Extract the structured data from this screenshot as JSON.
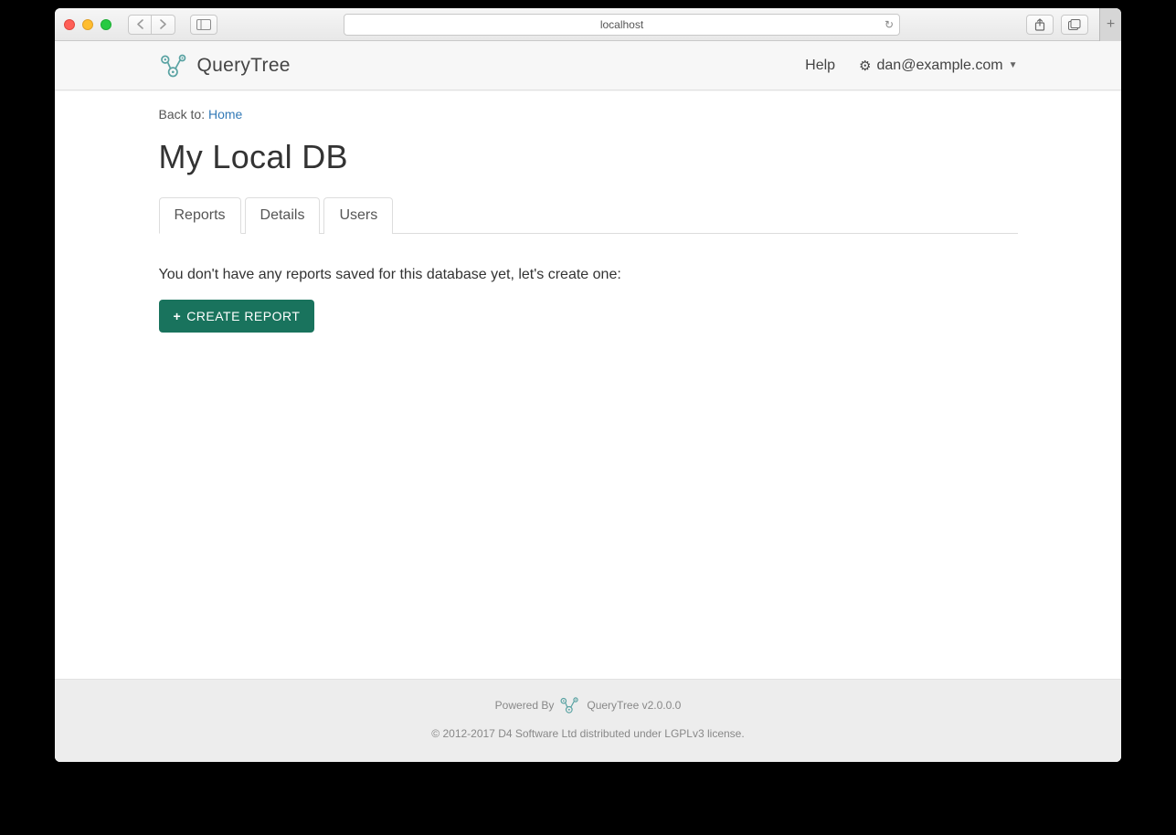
{
  "browser": {
    "url": "localhost"
  },
  "topnav": {
    "brand": "QueryTree",
    "help_label": "Help",
    "user_email": "dan@example.com"
  },
  "breadcrumb": {
    "prefix": "Back to: ",
    "link_label": "Home"
  },
  "page": {
    "title": "My Local DB"
  },
  "tabs": [
    {
      "label": "Reports",
      "active": true
    },
    {
      "label": "Details",
      "active": false
    },
    {
      "label": "Users",
      "active": false
    }
  ],
  "empty_state": {
    "message": "You don't have any reports saved for this database yet, let's create one:",
    "button_label": "CREATE REPORT"
  },
  "footer": {
    "powered_by_prefix": "Powered By",
    "product": "QueryTree v2.0.0.0",
    "copyright": "© 2012-2017 D4 Software Ltd distributed under LGPLv3 license."
  }
}
